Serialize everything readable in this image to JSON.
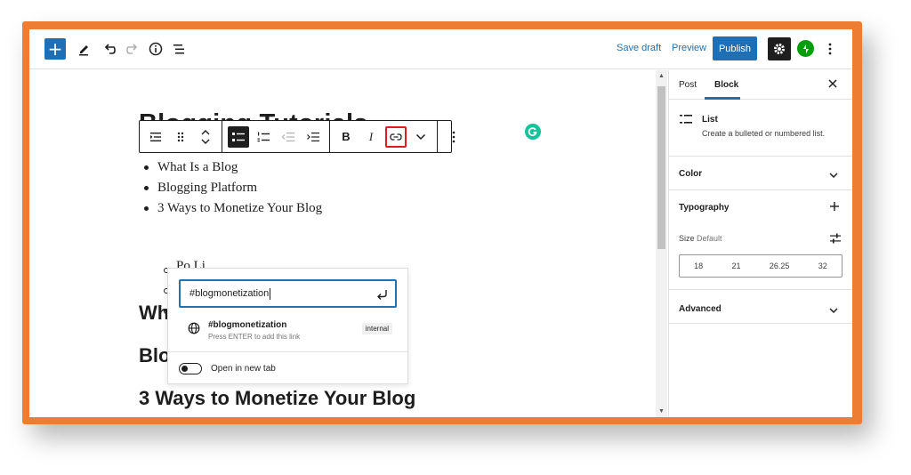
{
  "toolbar": {
    "inserter_icon": "plus-icon",
    "tools_icon": "pencil-icon",
    "undo_icon": "undo-icon",
    "redo_icon": "redo-icon",
    "details_icon": "info-icon",
    "outline_icon": "list-view-icon",
    "save_draft_label": "Save draft",
    "preview_label": "Preview",
    "publish_label": "Publish",
    "settings_icon": "gear-icon",
    "jetpack_icon": "jetpack-icon",
    "more_icon": "more-vertical-icon"
  },
  "editor": {
    "post_title": "Blogging Tutorials",
    "list_items": [
      "What Is a Blog",
      "Blogging Platform",
      "3 Ways to Monetize Your Blog"
    ],
    "sub_item_partial": "Po         Li",
    "heading_partial": "Wh",
    "heading_2": "Blogging Platform",
    "heading_3": "3 Ways to Monetize Your Blog"
  },
  "block_toolbar": {
    "buttons": [
      "block-type-icon",
      "drag-handle-icon",
      "move-arrows-icon",
      "unordered-list-icon",
      "ordered-list-icon",
      "outdent-icon",
      "indent-icon",
      "bold-icon",
      "italic-icon",
      "link-icon",
      "more-formatting-chevron-icon",
      "block-options-icon"
    ],
    "bold_label": "B",
    "italic_label": "I"
  },
  "link_popover": {
    "input_value": "#blogmonetization",
    "suggestion_title": "#blogmonetization",
    "suggestion_hint": "Press ENTER to add this link",
    "suggestion_badge": "internal",
    "open_new_tab_label": "Open in new tab",
    "open_new_tab_on": false
  },
  "sidebar": {
    "tabs": [
      "Post",
      "Block"
    ],
    "active_tab": "Block",
    "block_name": "List",
    "block_description": "Create a bulleted or numbered list.",
    "panels": {
      "color": "Color",
      "typography": "Typography",
      "size_label": "Size",
      "size_default": "Default",
      "font_sizes": [
        "18",
        "21",
        "26.25",
        "32"
      ],
      "advanced": "Advanced"
    }
  },
  "colors": {
    "frame_accent": "#ec7d32",
    "wp_blue": "#1e6fb5",
    "link_highlight": "#e11b22",
    "grammarly": "#15c39a",
    "jetpack": "#069e08"
  }
}
